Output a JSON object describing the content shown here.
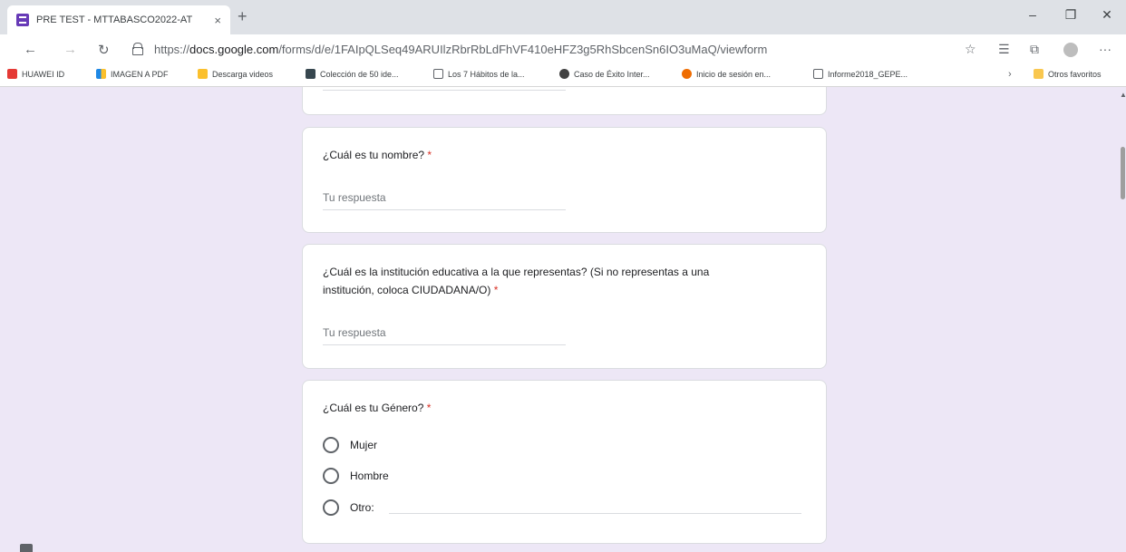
{
  "browser": {
    "tab_title": "PRE TEST - MTTABASCO2022-AT",
    "tab_close": "×",
    "new_tab": "+",
    "url_prefix": "https://",
    "url_domain": "docs.google.com",
    "url_path": "/forms/d/e/1FAIpQLSeq49ARUIlzRbrRbLdFhVF410eHFZ3g5RhSbcenSn6IO3uMaQ/viewform",
    "minimize": "–",
    "restore": "❐",
    "close": "✕",
    "more": "···"
  },
  "bookmarks": [
    {
      "label": "HUAWEI ID",
      "color": "#e53935"
    },
    {
      "label": "IMAGEN A PDF",
      "color": "#1e88e5"
    },
    {
      "label": "Descarga videos",
      "color": "#fbc02d"
    },
    {
      "label": "Colección de 50 ide...",
      "color": "#37474f"
    },
    {
      "label": "Los 7 Hábitos de la...",
      "color": "#ffffff"
    },
    {
      "label": "Caso de Éxito Inter...",
      "color": "#424242"
    },
    {
      "label": "Inicio de sesión en...",
      "color": "#ef6c00"
    },
    {
      "label": "Informe2018_GEPE...",
      "color": "#ffffff"
    }
  ],
  "bookmarks_other": "Otros favoritos",
  "form": {
    "q_name": {
      "title": "¿Cuál es tu nombre?",
      "required": "*",
      "placeholder": "Tu respuesta"
    },
    "q_institution": {
      "title_line1": "¿Cuál es la institución educativa a la que representas? (Si no representas a una",
      "title_line2": "institución, coloca CIUDADANA/O)",
      "required": "*",
      "placeholder": "Tu respuesta"
    },
    "q_gender": {
      "title": "¿Cuál es tu Género?",
      "required": "*",
      "options": [
        "Mujer",
        "Hombre",
        "Otro:"
      ]
    }
  }
}
